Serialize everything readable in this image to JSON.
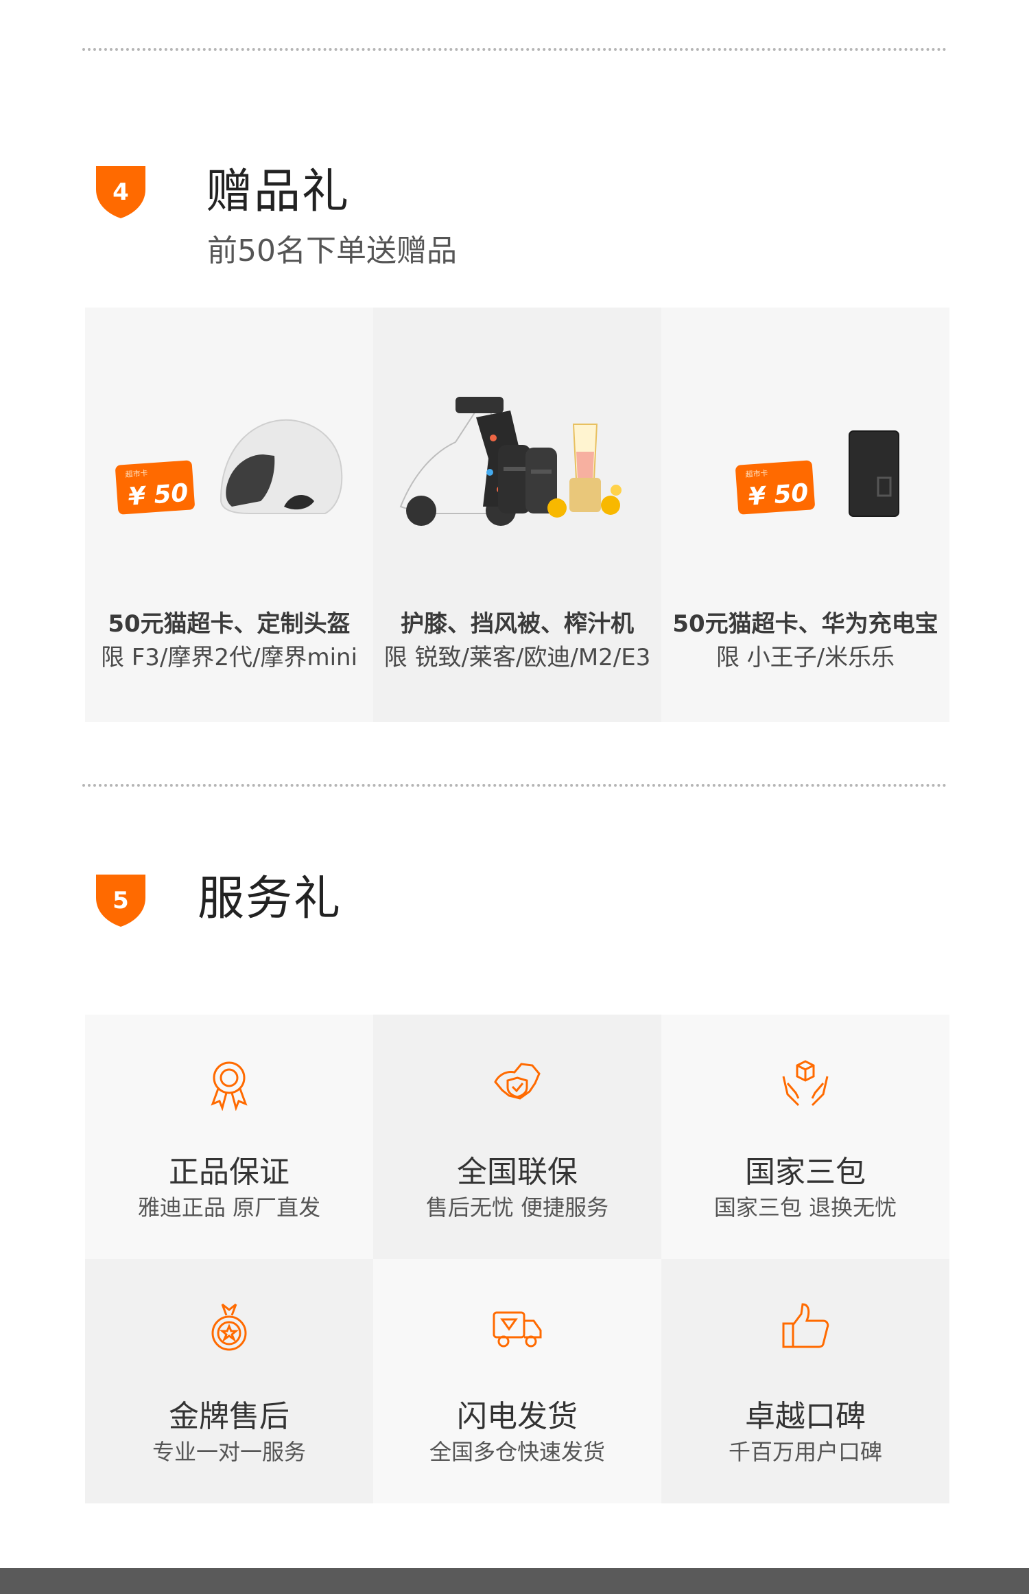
{
  "colors": {
    "accent": "#ff6a00",
    "gray_bar": "#5a5a5a"
  },
  "section4": {
    "number": "4",
    "title": "赠品礼",
    "subtitle": "前50名下单送赠品",
    "gifts": [
      {
        "title": "50元猫超卡、定制头盔",
        "sub": "限 F3/摩界2代/摩界mini",
        "card_label": "超市卡",
        "card_value": "¥ 50",
        "icons": [
          "gift-card-icon",
          "helmet-icon"
        ]
      },
      {
        "title": "护膝、挡风被、榨汁机",
        "sub": "限 锐致/莱客/欧迪/M2/E3",
        "icons": [
          "scooter-icon",
          "knee-pads-icon",
          "juicer-icon"
        ]
      },
      {
        "title": "50元猫超卡、华为充电宝",
        "sub": "限 小王子/米乐乐",
        "card_label": "超市卡",
        "card_value": "¥ 50",
        "icons": [
          "gift-card-icon",
          "power-bank-icon"
        ]
      }
    ]
  },
  "section5": {
    "number": "5",
    "title": "服务礼",
    "services": [
      {
        "icon": "medal-ribbon-icon",
        "title": "正品保证",
        "sub": "雅迪正品 原厂直发"
      },
      {
        "icon": "china-map-shield-icon",
        "title": "全国联保",
        "sub": "售后无忧 便捷服务"
      },
      {
        "icon": "hands-box-icon",
        "title": "国家三包",
        "sub": "国家三包 退换无忧"
      },
      {
        "icon": "gold-medal-icon",
        "title": "金牌售后",
        "sub": "专业一对一服务"
      },
      {
        "icon": "delivery-truck-icon",
        "title": "闪电发货",
        "sub": "全国多仓快速发货"
      },
      {
        "icon": "thumbs-up-icon",
        "title": "卓越口碑",
        "sub": "千百万用户口碑"
      }
    ]
  }
}
